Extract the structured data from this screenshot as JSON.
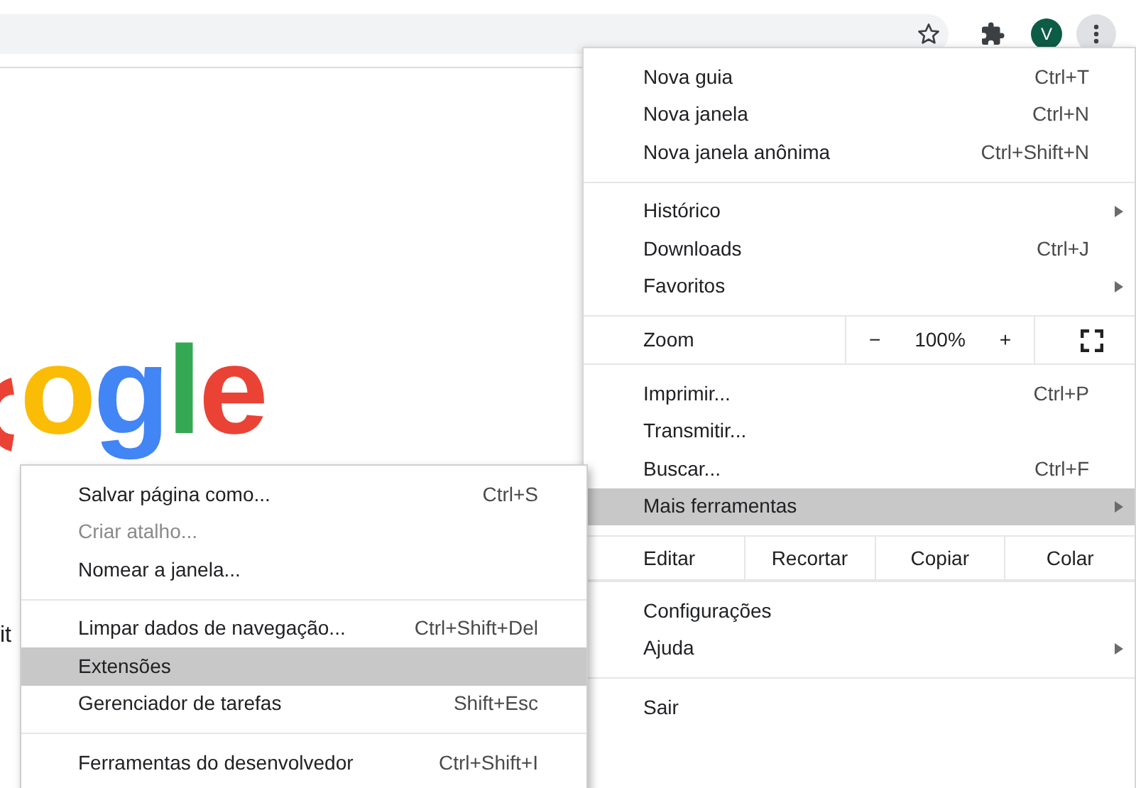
{
  "toolbar": {
    "avatar": "V"
  },
  "page": {
    "logo_text": "ogle",
    "search_text": "it"
  },
  "menu": {
    "sections": [
      {
        "kind": "items",
        "items": [
          {
            "label": "Nova guia",
            "shortcut": "Ctrl+T",
            "submenu": false,
            "selected": false
          },
          {
            "label": "Nova janela",
            "shortcut": "Ctrl+N",
            "submenu": false,
            "selected": false
          },
          {
            "label": "Nova janela anônima",
            "shortcut": "Ctrl+Shift+N",
            "submenu": false,
            "selected": false
          }
        ]
      },
      {
        "kind": "items",
        "items": [
          {
            "label": "Histórico",
            "submenu": true,
            "selected": false
          },
          {
            "label": "Downloads",
            "shortcut": "Ctrl+J",
            "submenu": false,
            "selected": false
          },
          {
            "label": "Favoritos",
            "submenu": true,
            "selected": false
          }
        ]
      },
      {
        "kind": "zoom",
        "label": "Zoom",
        "minus": "−",
        "value": "100%",
        "plus": "+"
      },
      {
        "kind": "items",
        "items": [
          {
            "label": "Imprimir...",
            "shortcut": "Ctrl+P",
            "submenu": false,
            "selected": false
          },
          {
            "label": "Transmitir...",
            "submenu": false,
            "selected": false
          },
          {
            "label": "Buscar...",
            "shortcut": "Ctrl+F",
            "submenu": false,
            "selected": false
          },
          {
            "label": "Mais ferramentas",
            "submenu": true,
            "selected": true
          }
        ]
      },
      {
        "kind": "edit",
        "label": "Editar",
        "buttons": [
          "Recortar",
          "Copiar",
          "Colar"
        ]
      },
      {
        "kind": "items",
        "items": [
          {
            "label": "Configurações",
            "submenu": false,
            "selected": false
          },
          {
            "label": "Ajuda",
            "submenu": true,
            "selected": false
          }
        ]
      },
      {
        "kind": "items",
        "items": [
          {
            "label": "Sair",
            "submenu": false,
            "selected": false
          }
        ]
      }
    ]
  },
  "submenu": {
    "sections": [
      [
        {
          "label": "Salvar página como...",
          "shortcut": "Ctrl+S",
          "disabled": false,
          "selected": false
        },
        {
          "label": "Criar atalho...",
          "disabled": true,
          "selected": false
        },
        {
          "label": "Nomear a janela...",
          "disabled": false,
          "selected": false
        }
      ],
      [
        {
          "label": "Limpar dados de navegação...",
          "shortcut": "Ctrl+Shift+Del",
          "disabled": false,
          "selected": false
        },
        {
          "label": "Extensões",
          "disabled": false,
          "selected": true
        },
        {
          "label": "Gerenciador de tarefas",
          "shortcut": "Shift+Esc",
          "disabled": false,
          "selected": false
        }
      ],
      [
        {
          "label": "Ferramentas do desenvolvedor",
          "shortcut": "Ctrl+Shift+I",
          "disabled": false,
          "selected": false
        }
      ]
    ]
  }
}
